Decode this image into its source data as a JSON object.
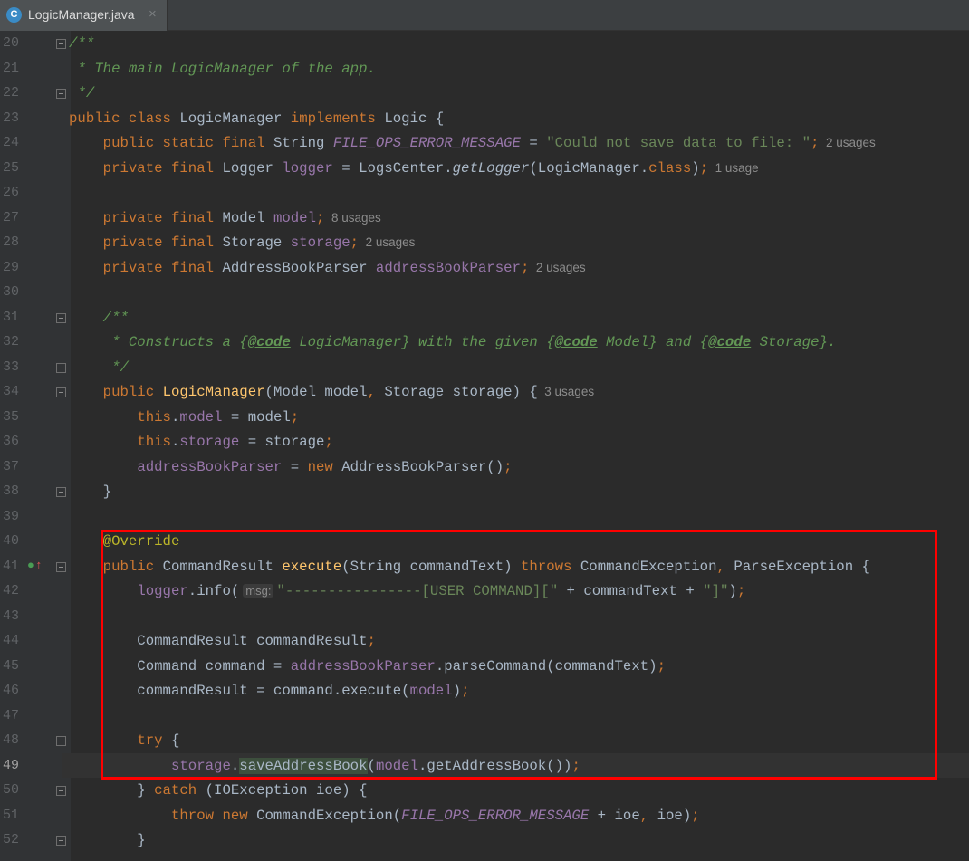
{
  "tab": {
    "title": "LogicManager.java",
    "icon": "C",
    "close": "×"
  },
  "gutter": {
    "lines": [
      "20",
      "21",
      "22",
      "23",
      "24",
      "25",
      "26",
      "27",
      "28",
      "29",
      "30",
      "31",
      "32",
      "33",
      "34",
      "35",
      "36",
      "37",
      "38",
      "39",
      "40",
      "41",
      "42",
      "43",
      "44",
      "45",
      "46",
      "47",
      "48",
      "49",
      "50",
      "51",
      "52"
    ],
    "current_line": "49"
  },
  "code_lines": [
    [
      [
        "cm",
        "/**"
      ]
    ],
    [
      [
        "cm",
        " * The main LogicManager of the app."
      ]
    ],
    [
      [
        "cm",
        " */"
      ]
    ],
    [
      [
        "kw",
        "public class "
      ],
      [
        "p",
        "LogicManager "
      ],
      [
        "kw",
        "implements "
      ],
      [
        "p",
        "Logic {"
      ]
    ],
    [
      [
        "p",
        "    "
      ],
      [
        "kw",
        "public static final "
      ],
      [
        "p",
        "String "
      ],
      [
        "const",
        "FILE_OPS_ERROR_MESSAGE"
      ],
      [
        "p",
        " = "
      ],
      [
        "str",
        "\"Could not save data to file: \""
      ],
      [
        "kw",
        ";"
      ],
      [
        "hint",
        "  2 usages"
      ]
    ],
    [
      [
        "p",
        "    "
      ],
      [
        "kw",
        "private final "
      ],
      [
        "p",
        "Logger "
      ],
      [
        "fld",
        "logger"
      ],
      [
        "p",
        " = LogsCenter."
      ],
      [
        "static",
        "getLogger"
      ],
      [
        "p",
        "(LogicManager."
      ],
      [
        "kw",
        "class"
      ],
      [
        "p",
        ")"
      ],
      [
        "kw",
        ";"
      ],
      [
        "hint",
        "  1 usage"
      ]
    ],
    [],
    [
      [
        "p",
        "    "
      ],
      [
        "kw",
        "private final "
      ],
      [
        "p",
        "Model "
      ],
      [
        "fld",
        "model"
      ],
      [
        "kw",
        ";"
      ],
      [
        "hint",
        "  8 usages"
      ]
    ],
    [
      [
        "p",
        "    "
      ],
      [
        "kw",
        "private final "
      ],
      [
        "p",
        "Storage "
      ],
      [
        "fld",
        "storage"
      ],
      [
        "kw",
        ";"
      ],
      [
        "hint",
        "  2 usages"
      ]
    ],
    [
      [
        "p",
        "    "
      ],
      [
        "kw",
        "private final "
      ],
      [
        "p",
        "AddressBookParser "
      ],
      [
        "fld",
        "addressBookParser"
      ],
      [
        "kw",
        ";"
      ],
      [
        "hint",
        "  2 usages"
      ]
    ],
    [],
    [
      [
        "cm",
        "    /**"
      ]
    ],
    [
      [
        "cm",
        "     * Constructs a {"
      ],
      [
        "tag",
        "@code"
      ],
      [
        "cm",
        " LogicManager} with the given {"
      ],
      [
        "tag",
        "@code"
      ],
      [
        "cm",
        " Model} and {"
      ],
      [
        "tag",
        "@code"
      ],
      [
        "cm",
        " Storage}."
      ]
    ],
    [
      [
        "cm",
        "     */"
      ]
    ],
    [
      [
        "p",
        "    "
      ],
      [
        "kw",
        "public "
      ],
      [
        "fn",
        "LogicManager"
      ],
      [
        "p",
        "(Model model"
      ],
      [
        "kw",
        ", "
      ],
      [
        "p",
        "Storage storage) {"
      ],
      [
        "hint",
        "  3 usages"
      ]
    ],
    [
      [
        "p",
        "        "
      ],
      [
        "kw",
        "this"
      ],
      [
        "p",
        "."
      ],
      [
        "fld",
        "model"
      ],
      [
        "p",
        " = model"
      ],
      [
        "kw",
        ";"
      ]
    ],
    [
      [
        "p",
        "        "
      ],
      [
        "kw",
        "this"
      ],
      [
        "p",
        "."
      ],
      [
        "fld",
        "storage"
      ],
      [
        "p",
        " = storage"
      ],
      [
        "kw",
        ";"
      ]
    ],
    [
      [
        "p",
        "        "
      ],
      [
        "fld",
        "addressBookParser"
      ],
      [
        "p",
        " = "
      ],
      [
        "kw",
        "new "
      ],
      [
        "p",
        "AddressBookParser()"
      ],
      [
        "kw",
        ";"
      ]
    ],
    [
      [
        "p",
        "    }"
      ]
    ],
    [],
    [
      [
        "p",
        "    "
      ],
      [
        "ann",
        "@Override"
      ]
    ],
    [
      [
        "p",
        "    "
      ],
      [
        "kw",
        "public "
      ],
      [
        "p",
        "CommandResult "
      ],
      [
        "fn",
        "execute"
      ],
      [
        "p",
        "(String commandText) "
      ],
      [
        "kw",
        "throws "
      ],
      [
        "p",
        "CommandException"
      ],
      [
        "kw",
        ", "
      ],
      [
        "p",
        "ParseException {"
      ]
    ],
    [
      [
        "p",
        "        "
      ],
      [
        "fld",
        "logger"
      ],
      [
        "p",
        ".info("
      ],
      [
        "param",
        "msg:"
      ],
      [
        "str",
        "\"----------------[USER COMMAND][\""
      ],
      [
        "p",
        " + commandText + "
      ],
      [
        "str",
        "\"]\""
      ],
      [
        "p",
        ")"
      ],
      [
        "kw",
        ";"
      ]
    ],
    [],
    [
      [
        "p",
        "        CommandResult commandResult"
      ],
      [
        "kw",
        ";"
      ]
    ],
    [
      [
        "p",
        "        Command command = "
      ],
      [
        "fld",
        "addressBookParser"
      ],
      [
        "p",
        ".parseCommand(commandText)"
      ],
      [
        "kw",
        ";"
      ]
    ],
    [
      [
        "p",
        "        commandResult = command.execute("
      ],
      [
        "fld",
        "model"
      ],
      [
        "p",
        ")"
      ],
      [
        "kw",
        ";"
      ]
    ],
    [],
    [
      [
        "p",
        "        "
      ],
      [
        "kw",
        "try "
      ],
      [
        "p",
        "{"
      ]
    ],
    [
      [
        "p",
        "            "
      ],
      [
        "fld",
        "storage"
      ],
      [
        "p",
        "."
      ],
      [
        "usage",
        "saveAddressBook"
      ],
      [
        "p",
        "("
      ],
      [
        "fld",
        "model"
      ],
      [
        "p",
        ".getAddressBook())"
      ],
      [
        "kw",
        ";"
      ]
    ],
    [
      [
        "p",
        "        } "
      ],
      [
        "kw",
        "catch "
      ],
      [
        "p",
        "(IOException ioe) {"
      ]
    ],
    [
      [
        "p",
        "            "
      ],
      [
        "kw",
        "throw new "
      ],
      [
        "p",
        "CommandException("
      ],
      [
        "const",
        "FILE_OPS_ERROR_MESSAGE"
      ],
      [
        "p",
        " + ioe"
      ],
      [
        "kw",
        ", "
      ],
      [
        "p",
        "ioe)"
      ],
      [
        "kw",
        ";"
      ]
    ],
    [
      [
        "p",
        "        }"
      ]
    ]
  ],
  "folds": {
    "0": "open",
    "2": "end",
    "11": "open",
    "13": "end",
    "14": "open",
    "18": "end",
    "21": "open",
    "28": "open",
    "30": "end",
    "32": "end"
  },
  "gutter_icons": {
    "21": [
      "override-icon",
      "implements-icon"
    ]
  },
  "colors": {
    "background": "#2b2b2b",
    "gutter": "#313335",
    "keyword": "#cc7832",
    "text": "#a9b7c6",
    "comment": "#629755",
    "field": "#9876aa",
    "string": "#6a8759",
    "method": "#ffc66d",
    "annotation": "#bbb529",
    "highlight_box": "#ff0000"
  }
}
